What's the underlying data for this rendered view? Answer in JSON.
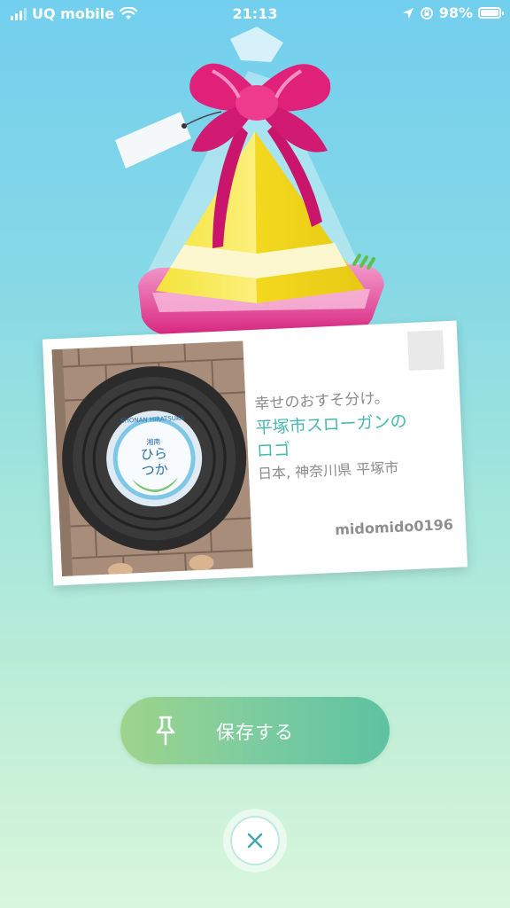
{
  "status_bar": {
    "carrier": "UQ mobile",
    "time": "21:13",
    "battery": "98%",
    "battery_level": 0.98,
    "icons": [
      "signal-icon",
      "wifi-icon",
      "location-arrow-icon",
      "orientation-lock-icon",
      "battery-icon"
    ]
  },
  "postcard": {
    "greeting": "幸せのおすそ分け。",
    "stop_name": "平塚市スローガンの\nロゴ",
    "location": "日本, 神奈川県 平塚市",
    "trainer": "midomido0196",
    "photo_text": [
      "SHONAN HIRATSUKA",
      "湘南",
      "ひら",
      "つか"
    ]
  },
  "actions": {
    "save_label": "保存する",
    "save_icon": "pin-icon",
    "close_icon": "close-icon"
  },
  "colors": {
    "accent": "#4ab8b0",
    "ribbon": "#e0217a",
    "gift_body": "#f7e83a"
  }
}
